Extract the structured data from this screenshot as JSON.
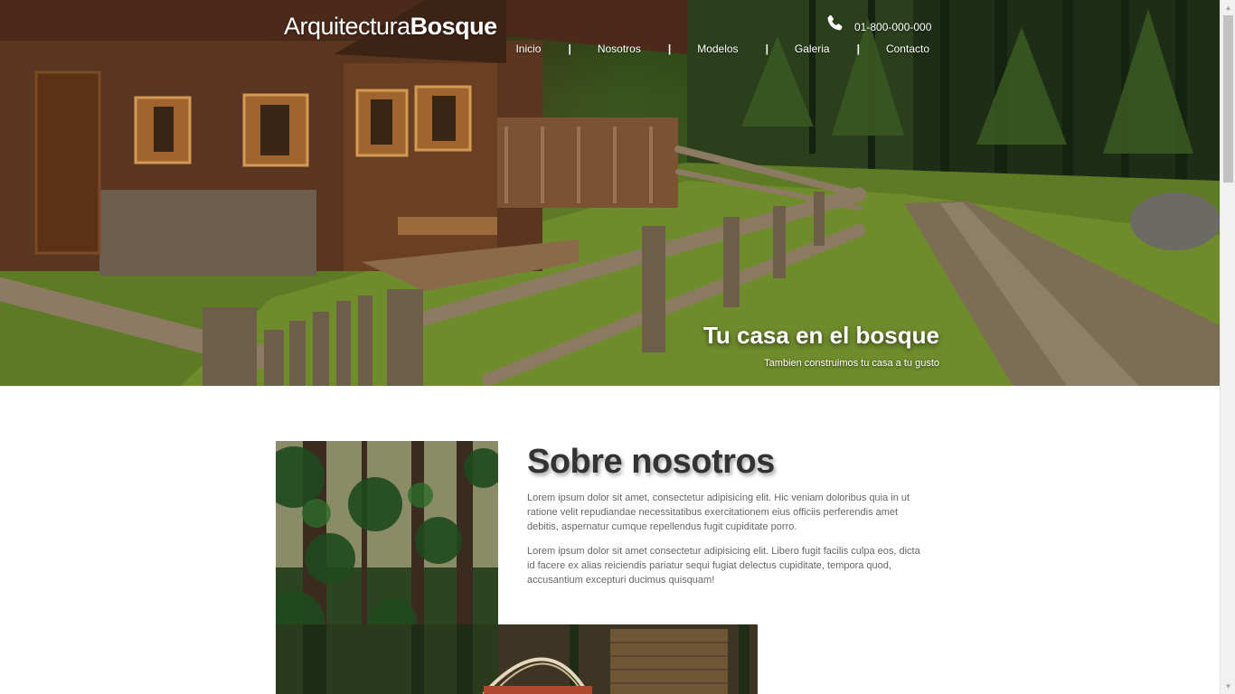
{
  "brand": {
    "logo_thin": "Arquitectura",
    "logo_bold": "Bosque"
  },
  "header": {
    "phone_icon": "phone-icon",
    "phone_number": "01-800-000-000",
    "nav": [
      "Inicio",
      "Nosotros",
      "Modelos",
      "Galeria",
      "Contacto"
    ],
    "separator": "|"
  },
  "hero": {
    "title": "Tu casa en el bosque",
    "subtitle": "Tambien construimos tu casa a tu gusto"
  },
  "about": {
    "title": "Sobre nosotros",
    "paragraphs": [
      "Lorem ipsum dolor sit amet, consectetur adipisicing elit. Hic veniam doloribus quia in ut ratione velit repudiandae necessitatibus exercitationem eius officiis perferendis amet debitis, aspernatur cumque repellendus fugit cupiditate porro.",
      "Lorem ipsum dolor sit amet consectetur adipisicing elit. Libero fugit facilis culpa eos, dicta id facere ex alias reiciendis pariatur sequi fugiat delectus cupiditate, tempora quod, accusantium excepturi ducimus quisquam!"
    ]
  },
  "colors": {
    "text_dark": "#333333",
    "text_body": "#666666",
    "white": "#ffffff"
  }
}
